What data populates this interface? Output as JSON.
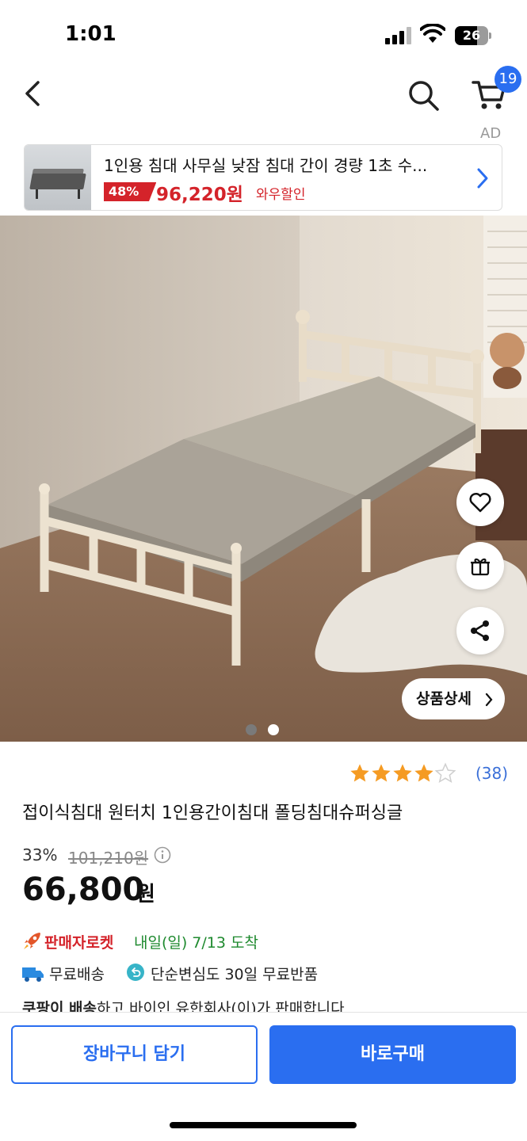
{
  "status_bar": {
    "time": "1:01",
    "battery": "26"
  },
  "nav": {
    "cart_count": "19",
    "ad_label": "AD"
  },
  "ad": {
    "title": "1인용 침대 사무실 낮잠 침대 간이 경량 1초 수...",
    "discount": "48%",
    "price": "96,220원",
    "tag": "와우할인"
  },
  "hero": {
    "detail_button": "상품상세",
    "image_count": 2,
    "current_image": 1,
    "colors": {
      "dot_active": "#7a7a7a",
      "dot_inactive": "#ffffff"
    }
  },
  "product": {
    "rating": 4,
    "rating_max": 5,
    "review_count": "(38)",
    "title": "접이식침대 원터치 1인용간이침대 폴딩침대슈퍼싱글",
    "discount_rate": "33%",
    "original_price": "101,210원",
    "sale_price": "66,800",
    "currency": "원"
  },
  "delivery": {
    "rocket_label": "판매자로켓",
    "arrival": "내일(일) 7/13 도착",
    "free_shipping": "무료배송",
    "free_return": "단순변심도 30일 무료반품",
    "seller_bold": "쿠팡이 배송",
    "seller_rest": "하고 바이인 유한회사(이)가 판매합니다"
  },
  "bottom": {
    "add_to_cart": "장바구니 담기",
    "buy_now": "바로구매"
  },
  "colors": {
    "accent": "#2a6ef0",
    "sale_red": "#d4232a",
    "arrival_green": "#1f8a2f",
    "star": "#f59b23"
  }
}
